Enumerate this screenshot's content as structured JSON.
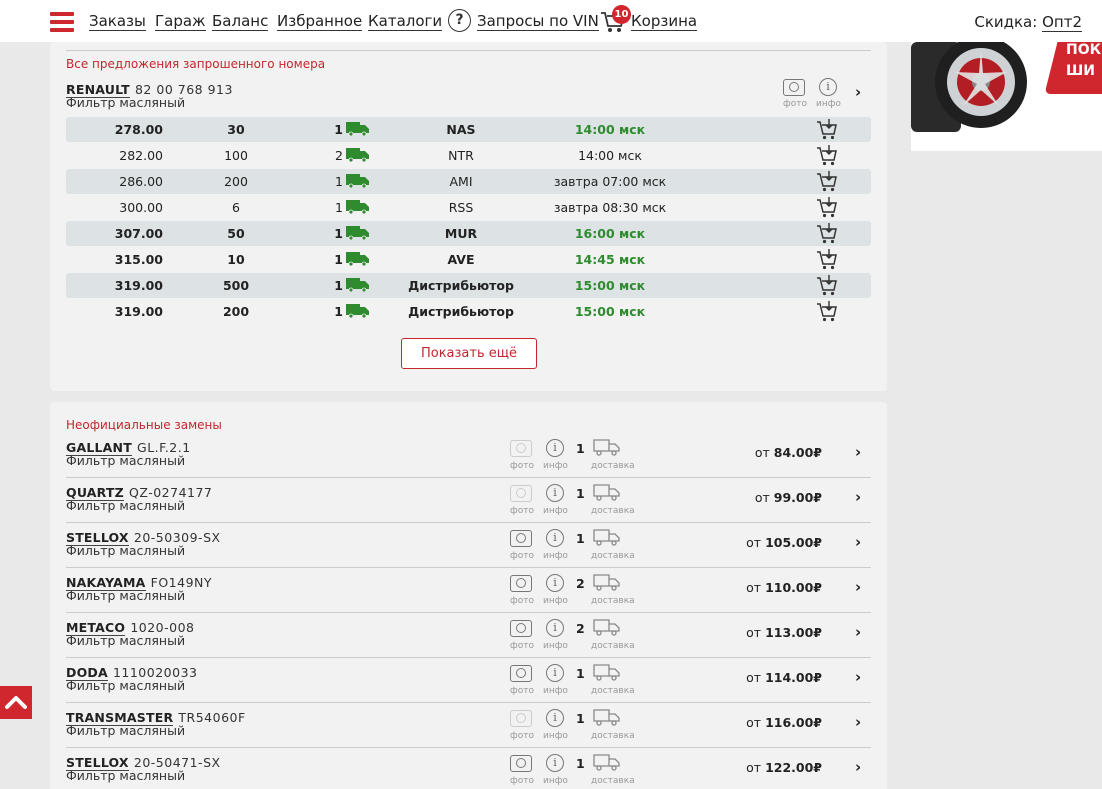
{
  "nav": {
    "links": [
      "Заказы",
      "Гараж",
      "Баланс",
      "Избранное",
      "Каталоги"
    ],
    "vin_icon": "?",
    "vin_label": "Запросы по VIN",
    "cart_label": "Корзина",
    "cart_count": "10",
    "discount_label": "Скидка:",
    "discount_value": "Опт2"
  },
  "ad": {
    "line1": "ПОК",
    "line2": "ШИ"
  },
  "offers": {
    "title": "Все предложения запрошенного номера",
    "brand": "RENAULT",
    "number": "82 00 768 913",
    "desc": "Фильтр масляный",
    "photo_label": "фото",
    "info_label": "инфо",
    "info_glyph": "i",
    "rows": [
      {
        "price": "278.00",
        "qty": "30",
        "count": "1",
        "supplier": "NAS",
        "time": "14:00 мск"
      },
      {
        "price": "282.00",
        "qty": "100",
        "count": "2",
        "supplier": "NTR",
        "time": "14:00 мск"
      },
      {
        "price": "286.00",
        "qty": "200",
        "count": "1",
        "supplier": "AMI",
        "time": "завтра 07:00 мск"
      },
      {
        "price": "300.00",
        "qty": "6",
        "count": "1",
        "supplier": "RSS",
        "time": "завтра 08:30 мск"
      },
      {
        "price": "307.00",
        "qty": "50",
        "count": "1",
        "supplier": "MUR",
        "time": "16:00 мск"
      },
      {
        "price": "315.00",
        "qty": "10",
        "count": "1",
        "supplier": "AVE",
        "time": "14:45 мск"
      },
      {
        "price": "319.00",
        "qty": "500",
        "count": "1",
        "supplier": "Дистрибьютор",
        "time": "15:00 мск"
      },
      {
        "price": "319.00",
        "qty": "200",
        "count": "1",
        "supplier": "Дистрибьютор",
        "time": "15:00 мск"
      }
    ],
    "show_more": "Показать ещё"
  },
  "replacements": {
    "title": "Неофициальные замены",
    "photo_label": "фото",
    "info_label": "инфо",
    "delivery_label": "доставка",
    "price_prefix": "от",
    "items": [
      {
        "brand": "GALLANT",
        "number": "GL.F.2.1",
        "desc": "Фильтр масляный",
        "count": "1",
        "price": "84.00₽"
      },
      {
        "brand": "QUARTZ",
        "number": "QZ-0274177",
        "desc": "Фильтр масляный",
        "count": "1",
        "price": "99.00₽"
      },
      {
        "brand": "STELLOX",
        "number": "20-50309-SX",
        "desc": "Фильтр масляный",
        "count": "1",
        "price": "105.00₽"
      },
      {
        "brand": "NAKAYAMA",
        "number": "FO149NY",
        "desc": "Фильтр масляный",
        "count": "2",
        "price": "110.00₽"
      },
      {
        "brand": "METACO",
        "number": "1020-008",
        "desc": "Фильтр масляный",
        "count": "2",
        "price": "113.00₽"
      },
      {
        "brand": "DODA",
        "number": "1110020033",
        "desc": "Фильтр масляный",
        "count": "1",
        "price": "114.00₽"
      },
      {
        "brand": "TRANSMASTER",
        "number": "TR54060F",
        "desc": "Фильтр масляный",
        "count": "1",
        "price": "116.00₽"
      },
      {
        "brand": "STELLOX",
        "number": "20-50471-SX",
        "desc": "Фильтр масляный",
        "count": "1",
        "price": "122.00₽"
      }
    ]
  },
  "colors": {
    "accent": "#d0262e",
    "green": "#2e8b2e",
    "row_shade": "#dde3e5"
  }
}
